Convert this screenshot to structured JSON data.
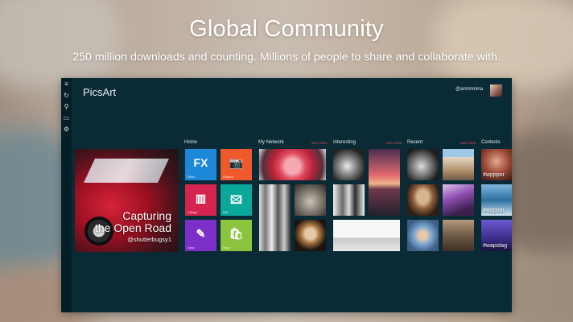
{
  "promo": {
    "headline": "Global Community",
    "subline": "250 million downloads and counting. Millions of people to share and collaborate with."
  },
  "app": {
    "title": "PicsArt",
    "username": "@arminmina",
    "sidebar": [
      "menu-icon",
      "refresh-icon",
      "search-icon",
      "chat-icon",
      "settings-icon"
    ],
    "sections": {
      "home": "Home",
      "network": "My Network",
      "interesting": "Interesting",
      "recent": "Recent",
      "contests": "Contests",
      "see_more": "See more"
    },
    "hero": {
      "line1": "Capturing",
      "line2": "the Open Road",
      "credit": "@shutterbugsy1"
    },
    "tiles": [
      {
        "label": "Effect",
        "glyph": "FX",
        "color": "#1e88d8"
      },
      {
        "label": "Camera",
        "glyph": "📷",
        "color": "#f0592b"
      },
      {
        "label": "Collage",
        "glyph": "▥",
        "color": "#d62450"
      },
      {
        "label": "Edit",
        "glyph": "🖾",
        "color": "#0aa79b"
      },
      {
        "label": "Draw",
        "glyph": "✎",
        "color": "#7b2fc6"
      },
      {
        "label": "Shop",
        "glyph": "🛍",
        "color": "#8cc43f"
      }
    ],
    "contests": [
      "#wpppor",
      "#wdpnar",
      "#wapstag"
    ]
  }
}
